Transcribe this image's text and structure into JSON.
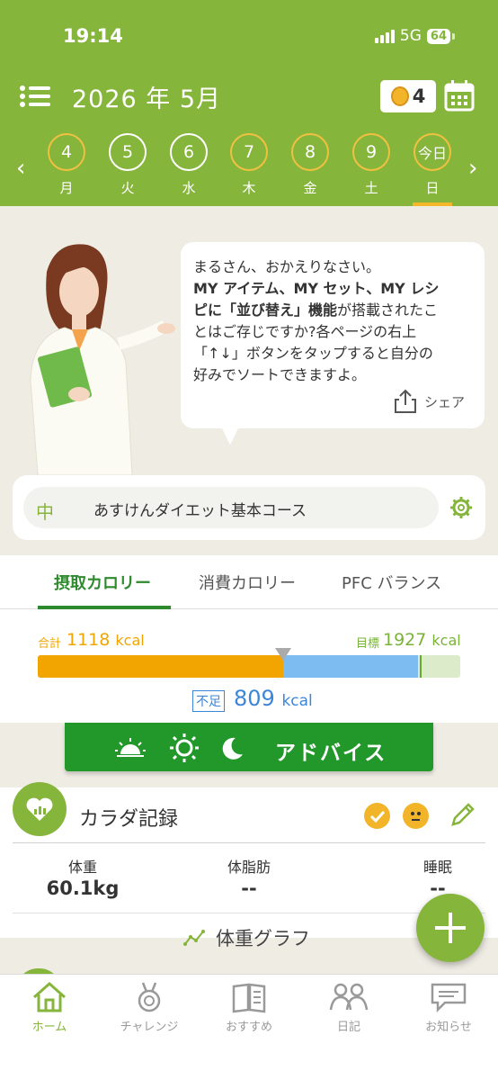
{
  "status_bar": {
    "time": "19:14",
    "network": "5G",
    "battery": "64"
  },
  "header": {
    "title": "2026 年 5月",
    "medal_count": "4",
    "prev_arrow": "‹",
    "next_arrow": "›",
    "days": [
      {
        "num": "4",
        "weekday": "月"
      },
      {
        "num": "5",
        "weekday": "火"
      },
      {
        "num": "6",
        "weekday": "水"
      },
      {
        "num": "7",
        "weekday": "木"
      },
      {
        "num": "8",
        "weekday": "金"
      },
      {
        "num": "9",
        "weekday": "土"
      },
      {
        "num": "今日",
        "weekday": "日"
      }
    ]
  },
  "advisor": {
    "line1": "まるさん、おかえりなさい。",
    "line2_bold": "MY アイテム、MY セット、MY レシ",
    "line3_bold_a": "ピに",
    "line3_bold_b": "「並び替え」",
    "line3_bold_c": "機能",
    "line3_rest": "が搭載されたこ",
    "line4": "とはご存じですか?各ページの右上",
    "line5": "「↑↓」ボタンをタップすると自分の",
    "line6": "好みでソートできますよ。",
    "share_label": "シェア"
  },
  "course": {
    "icon": "中",
    "label": "あすけんダイエット基本コース"
  },
  "calorie_tabs": [
    "摂取カロリー",
    "消費カロリー",
    "PFC バランス"
  ],
  "calorie": {
    "total_label": "合計",
    "total_value": "1118",
    "goal_label": "目標",
    "goal_value": "1927",
    "unit": "kcal",
    "shortage_label": "不足",
    "shortage_value": "809",
    "intake_fraction": 0.58,
    "goal_fraction": 0.9
  },
  "advice": {
    "label": "アドバイス"
  },
  "body_record": {
    "title": "カラダ記録",
    "stats": [
      {
        "label": "体重",
        "value": "60.1kg"
      },
      {
        "label": "体脂肪",
        "value": "--"
      },
      {
        "label": "睡眠",
        "value": "--"
      }
    ],
    "graph_link": "体重グラフ"
  },
  "tabbar": [
    {
      "label": "ホーム",
      "icon": "home-icon"
    },
    {
      "label": "チャレンジ",
      "icon": "medal-icon"
    },
    {
      "label": "おすすめ",
      "icon": "book-icon"
    },
    {
      "label": "日記",
      "icon": "people-icon"
    },
    {
      "label": "お知らせ",
      "icon": "chat-icon"
    }
  ],
  "colors": {
    "brand_green": "#86b53c",
    "dark_green": "#22972a",
    "orange": "#f2a500",
    "blue": "#3b86d9"
  }
}
